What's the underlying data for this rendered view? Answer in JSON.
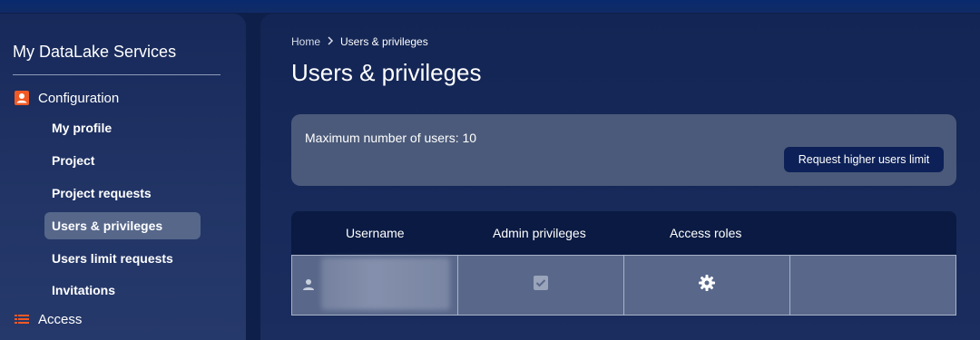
{
  "sidebar": {
    "title": "My DataLake Services",
    "sections": [
      {
        "label": "Configuration",
        "icon": "profile-card-icon",
        "color": "#f15a24"
      },
      {
        "label": "Access",
        "icon": "list-icon",
        "color": "#f15a24"
      }
    ],
    "items": [
      {
        "label": "My profile"
      },
      {
        "label": "Project"
      },
      {
        "label": "Project requests"
      },
      {
        "label": "Users & privileges",
        "active": true
      },
      {
        "label": "Users limit requests"
      },
      {
        "label": "Invitations"
      }
    ]
  },
  "breadcrumb": {
    "home": "Home",
    "current": "Users & privileges"
  },
  "page": {
    "title": "Users & privileges"
  },
  "limit": {
    "text": "Maximum number of users: 10",
    "button_label": "Request higher users limit"
  },
  "table": {
    "headers": [
      "Username",
      "Admin privileges",
      "Access roles"
    ],
    "rows": [
      {
        "username": "",
        "admin": true,
        "roles_icon": "gear-icon"
      }
    ]
  },
  "colors": {
    "accent": "#f15a24",
    "active_item": "#56678a",
    "button": "#0d2158"
  }
}
